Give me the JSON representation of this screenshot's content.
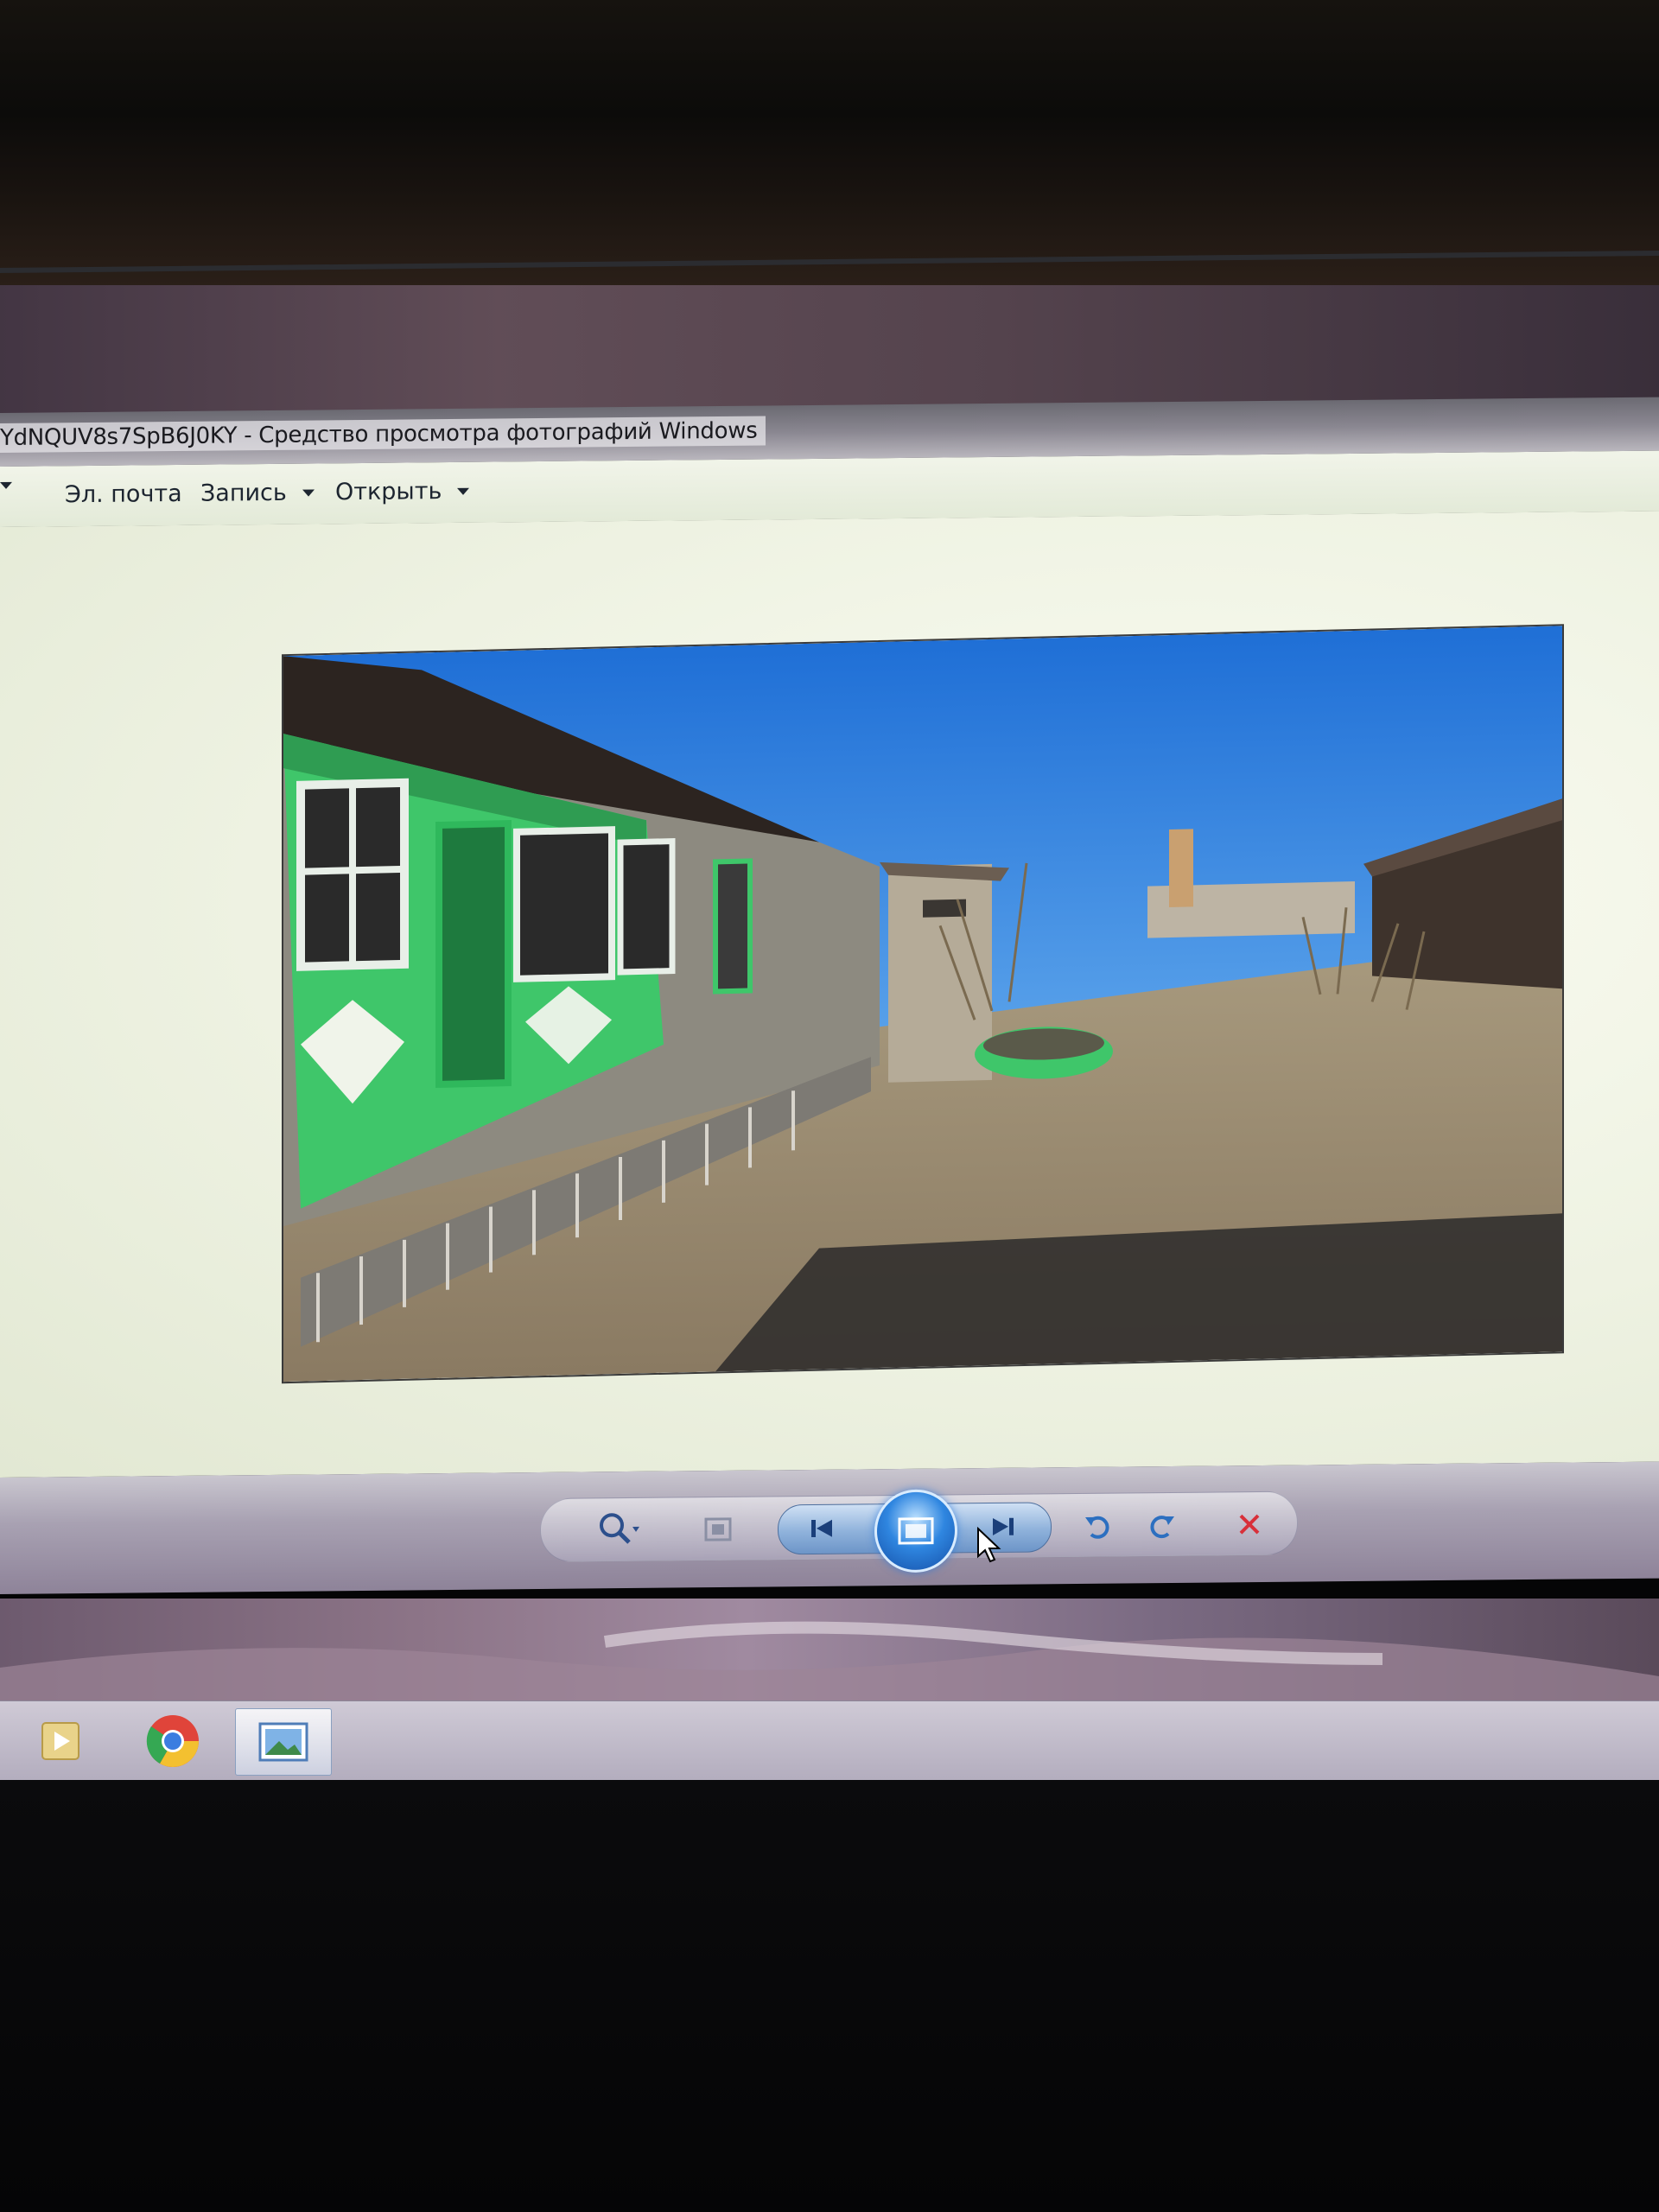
{
  "window": {
    "title": "YdNQUV8s7SpB6J0KY - Средство просмотра фотографий Windows"
  },
  "menu": {
    "items": [
      {
        "label": "Эл. почта",
        "has_arrow": false
      },
      {
        "label": "Запись",
        "has_arrow": true
      },
      {
        "label": "Открыть",
        "has_arrow": true
      }
    ]
  },
  "toolbar": {
    "buttons": [
      {
        "name": "zoom",
        "icon": "magnifier-icon"
      },
      {
        "name": "actual-size",
        "icon": "fit-window-icon"
      },
      {
        "name": "previous",
        "icon": "previous-icon"
      },
      {
        "name": "slideshow",
        "icon": "slideshow-icon"
      },
      {
        "name": "next",
        "icon": "next-icon"
      },
      {
        "name": "rotate-ccw",
        "icon": "rotate-left-icon"
      },
      {
        "name": "rotate-cw",
        "icon": "rotate-right-icon"
      },
      {
        "name": "delete",
        "icon": "delete-x-icon"
      }
    ]
  },
  "taskbar": {
    "apps": [
      {
        "name": "media-player",
        "icon": "media-player-icon"
      },
      {
        "name": "chrome",
        "icon": "chrome-icon"
      },
      {
        "name": "photo-viewer",
        "icon": "photo-viewer-icon",
        "active": true
      }
    ]
  },
  "colors": {
    "delete": "#d8303a",
    "nav_blue": "#2f86e0",
    "sky": "#2a78d8",
    "house_green": "#3fc66a"
  }
}
